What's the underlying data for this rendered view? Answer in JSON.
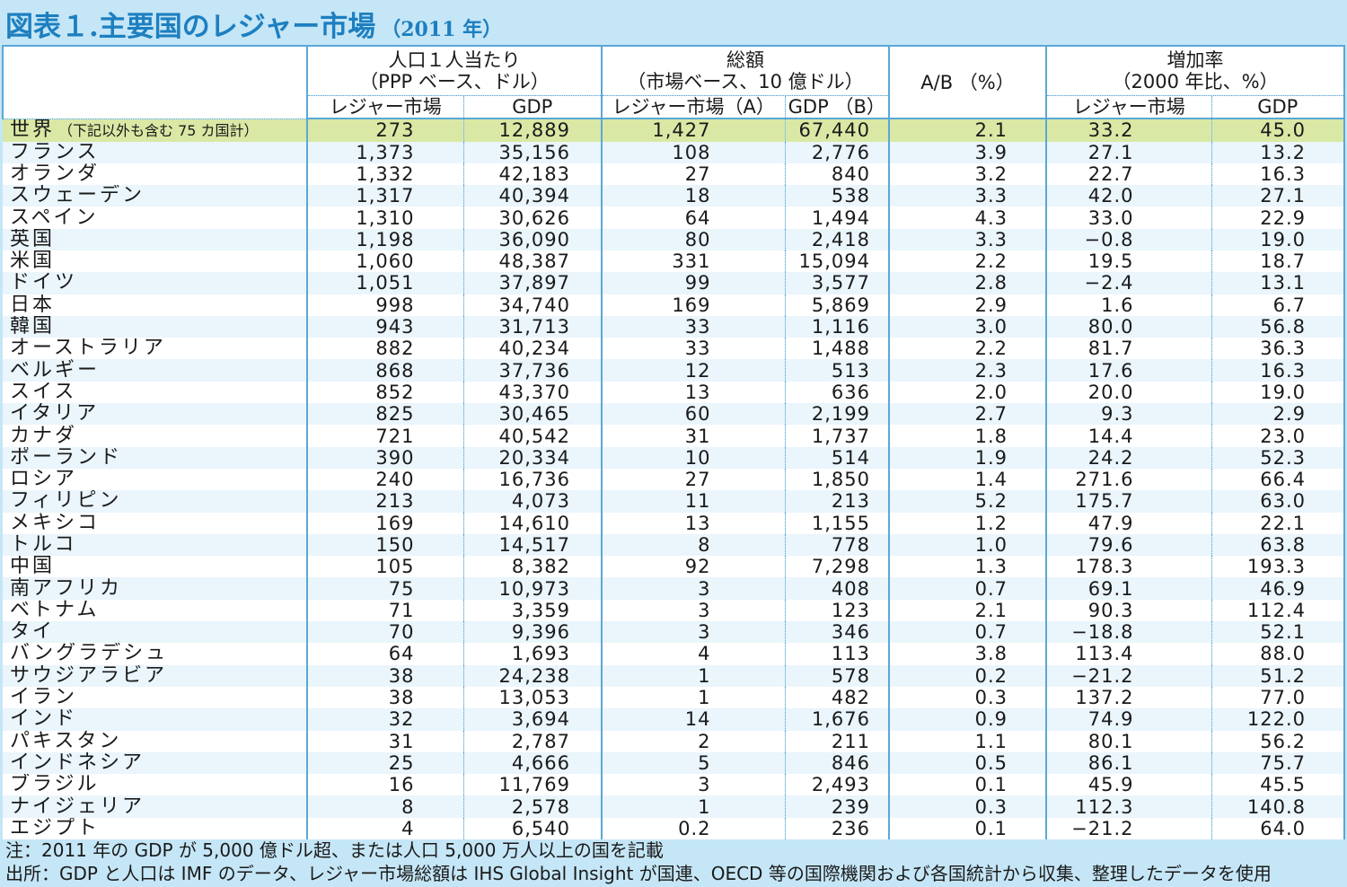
{
  "title": {
    "main": "図表１.主要国のレジャー市場",
    "sub": "（2011 年）"
  },
  "header": {
    "per_capita": "人口１人当たり\n（PPP ベース、ドル）",
    "total": "総額\n（市場ベース、10 億ドル）",
    "ratio": "A/B （%）",
    "growth": "増加率\n（2000 年比、%）",
    "leisure_market": "レジャー市場",
    "gdp": "GDP",
    "leisure_market_a": "レジャー市場（A）",
    "gdp_b": "GDP （B）",
    "growth_leisure": "レジャー市場",
    "growth_gdp": "GDP"
  },
  "world_note": "（下記以外も含む 75 カ国計）",
  "rows": [
    [
      "世界",
      "273",
      "12,889",
      "1,427",
      "67,440",
      "2.1",
      "33.2",
      "45.0"
    ],
    [
      "フランス",
      "1,373",
      "35,156",
      "108",
      "2,776",
      "3.9",
      "27.1",
      "13.2"
    ],
    [
      "オランダ",
      "1,332",
      "42,183",
      "27",
      "840",
      "3.2",
      "22.7",
      "16.3"
    ],
    [
      "スウェーデン",
      "1,317",
      "40,394",
      "18",
      "538",
      "3.3",
      "42.0",
      "27.1"
    ],
    [
      "スペイン",
      "1,310",
      "30,626",
      "64",
      "1,494",
      "4.3",
      "33.0",
      "22.9"
    ],
    [
      "英国",
      "1,198",
      "36,090",
      "80",
      "2,418",
      "3.3",
      "−0.8",
      "19.0"
    ],
    [
      "米国",
      "1,060",
      "48,387",
      "331",
      "15,094",
      "2.2",
      "19.5",
      "18.7"
    ],
    [
      "ドイツ",
      "1,051",
      "37,897",
      "99",
      "3,577",
      "2.8",
      "−2.4",
      "13.1"
    ],
    [
      "日本",
      "998",
      "34,740",
      "169",
      "5,869",
      "2.9",
      "1.6",
      "6.7"
    ],
    [
      "韓国",
      "943",
      "31,713",
      "33",
      "1,116",
      "3.0",
      "80.0",
      "56.8"
    ],
    [
      "オーストラリア",
      "882",
      "40,234",
      "33",
      "1,488",
      "2.2",
      "81.7",
      "36.3"
    ],
    [
      "ベルギー",
      "868",
      "37,736",
      "12",
      "513",
      "2.3",
      "17.6",
      "16.3"
    ],
    [
      "スイス",
      "852",
      "43,370",
      "13",
      "636",
      "2.0",
      "20.0",
      "19.0"
    ],
    [
      "イタリア",
      "825",
      "30,465",
      "60",
      "2,199",
      "2.7",
      "9.3",
      "2.9"
    ],
    [
      "カナダ",
      "721",
      "40,542",
      "31",
      "1,737",
      "1.8",
      "14.4",
      "23.0"
    ],
    [
      "ポーランド",
      "390",
      "20,334",
      "10",
      "514",
      "1.9",
      "24.2",
      "52.3"
    ],
    [
      "ロシア",
      "240",
      "16,736",
      "27",
      "1,850",
      "1.4",
      "271.6",
      "66.4"
    ],
    [
      "フィリピン",
      "213",
      "4,073",
      "11",
      "213",
      "5.2",
      "175.7",
      "63.0"
    ],
    [
      "メキシコ",
      "169",
      "14,610",
      "13",
      "1,155",
      "1.2",
      "47.9",
      "22.1"
    ],
    [
      "トルコ",
      "150",
      "14,517",
      "8",
      "778",
      "1.0",
      "79.6",
      "63.8"
    ],
    [
      "中国",
      "105",
      "8,382",
      "92",
      "7,298",
      "1.3",
      "178.3",
      "193.3"
    ],
    [
      "南アフリカ",
      "75",
      "10,973",
      "3",
      "408",
      "0.7",
      "69.1",
      "46.9"
    ],
    [
      "ベトナム",
      "71",
      "3,359",
      "3",
      "123",
      "2.1",
      "90.3",
      "112.4"
    ],
    [
      "タイ",
      "70",
      "9,396",
      "3",
      "346",
      "0.7",
      "−18.8",
      "52.1"
    ],
    [
      "バングラデシュ",
      "64",
      "1,693",
      "4",
      "113",
      "3.8",
      "113.4",
      "88.0"
    ],
    [
      "サウジアラビア",
      "38",
      "24,238",
      "1",
      "578",
      "0.2",
      "−21.2",
      "51.2"
    ],
    [
      "イラン",
      "38",
      "13,053",
      "1",
      "482",
      "0.3",
      "137.2",
      "77.0"
    ],
    [
      "インド",
      "32",
      "3,694",
      "14",
      "1,676",
      "0.9",
      "74.9",
      "122.0"
    ],
    [
      "パキスタン",
      "31",
      "2,787",
      "2",
      "211",
      "1.1",
      "80.1",
      "56.2"
    ],
    [
      "インドネシア",
      "25",
      "4,666",
      "5",
      "846",
      "0.5",
      "86.1",
      "75.7"
    ],
    [
      "ブラジル",
      "16",
      "11,769",
      "3",
      "2,493",
      "0.1",
      "45.9",
      "45.5"
    ],
    [
      "ナイジェリア",
      "8",
      "2,578",
      "1",
      "239",
      "0.3",
      "112.3",
      "140.8"
    ],
    [
      "エジプト",
      "4",
      "6,540",
      "0.2",
      "236",
      "0.1",
      "−21.2",
      "64.0"
    ]
  ],
  "notes": {
    "note": "注：2011 年の GDP が 5,000 億ドル超、または人口 5,000 万人以上の国を記載",
    "source": "出所：GDP と人口は IMF のデータ、レジャー市場総額は IHS Global Insight が国連、OECD 等の国際機関および各国統計から収集、整理したデータを使用"
  },
  "colors": {
    "title": "#1d7fc0",
    "background": "#c5e6f6",
    "border": "#5aa8d6",
    "world_row": "#d9e8a4",
    "alt_row": "#eaf5fc"
  }
}
